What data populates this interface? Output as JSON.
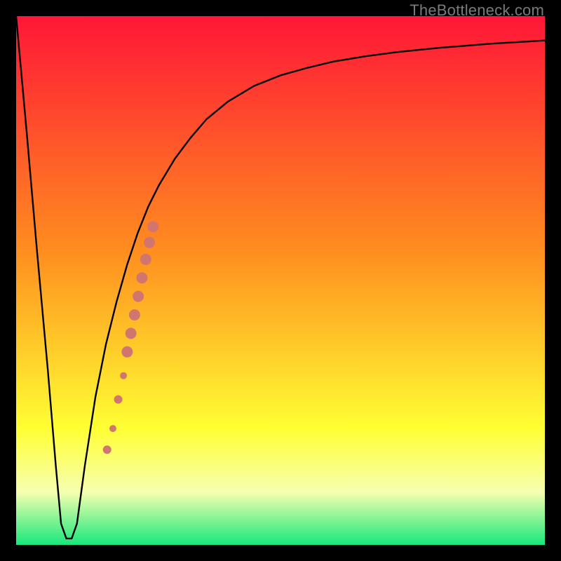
{
  "watermark": "TheBottleneck.com",
  "colors": {
    "frame": "#000000",
    "curve": "#000000",
    "marker": "#d1766f",
    "gradient_top": "#ff1637",
    "gradient_mid1": "#ff8f1f",
    "gradient_mid2": "#ffff33",
    "gradient_pale": "#f6ffb0",
    "gradient_bottom": "#17e87b"
  },
  "chart_data": {
    "type": "line",
    "title": "",
    "xlabel": "",
    "ylabel": "",
    "xlim": [
      0,
      100
    ],
    "ylim": [
      0,
      100
    ],
    "curve": {
      "x": [
        0,
        2,
        4,
        6,
        7.5,
        8.5,
        9.5,
        10.5,
        11.5,
        13,
        15,
        17,
        19,
        21,
        23,
        25,
        27,
        30,
        33,
        36,
        40,
        45,
        50,
        55,
        60,
        66,
        72,
        80,
        90,
        100
      ],
      "y": [
        100,
        78,
        55,
        33,
        15,
        4,
        1.2,
        1.2,
        4,
        15,
        28,
        38,
        46,
        53,
        59,
        64,
        68,
        73,
        77,
        80.5,
        83.8,
        86.8,
        88.8,
        90.2,
        91.4,
        92.4,
        93.2,
        94.0,
        94.8,
        95.4
      ]
    },
    "flat_bottom": {
      "x_start": 8.5,
      "x_end": 10.5,
      "y": 1.2
    },
    "markers": [
      {
        "x": 17.2,
        "y": 18.0,
        "r": 6.0
      },
      {
        "x": 18.3,
        "y": 22.0,
        "r": 5.0
      },
      {
        "x": 19.3,
        "y": 27.5,
        "r": 6.0
      },
      {
        "x": 20.3,
        "y": 32.0,
        "r": 5.0
      },
      {
        "x": 21.0,
        "y": 36.5,
        "r": 8.0
      },
      {
        "x": 21.7,
        "y": 40.0,
        "r": 8.0
      },
      {
        "x": 22.4,
        "y": 43.5,
        "r": 8.0
      },
      {
        "x": 23.1,
        "y": 47.0,
        "r": 8.0
      },
      {
        "x": 23.8,
        "y": 50.5,
        "r": 8.0
      },
      {
        "x": 24.5,
        "y": 54.0,
        "r": 8.0
      },
      {
        "x": 25.2,
        "y": 57.2,
        "r": 8.0
      },
      {
        "x": 25.9,
        "y": 60.2,
        "r": 8.0
      }
    ]
  }
}
